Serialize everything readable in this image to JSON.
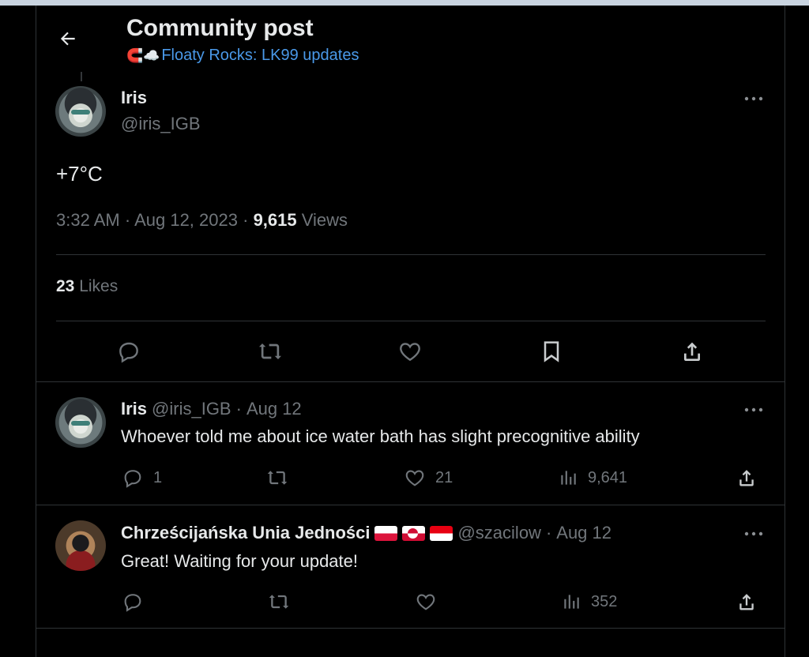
{
  "header": {
    "title": "Community post",
    "community_emoji": "🧲☁️",
    "community_name": "Floaty Rocks: LK99 updates"
  },
  "main_post": {
    "author_name": "Iris",
    "author_handle": "@iris_IGB",
    "text": "+7°C",
    "time": "3:32 AM",
    "date": "Aug 12, 2023",
    "views_count": "9,615",
    "views_label": "Views",
    "likes_count": "23",
    "likes_label": "Likes"
  },
  "replies": [
    {
      "author_name": "Iris",
      "author_handle": "@iris_IGB",
      "date": "Aug 12",
      "text": "Whoever told me about ice water bath has slight precognitive ability",
      "reply_count": "1",
      "like_count": "21",
      "view_count": "9,641"
    },
    {
      "author_name": "Chrześcijańska Unia Jedności",
      "author_handle": "@szacilow",
      "date": "Aug 12",
      "text": "Great! Waiting for your update!",
      "reply_count": "",
      "like_count": "",
      "view_count": "352"
    }
  ],
  "separator": "·",
  "colors": {
    "background": "#000000",
    "text": "#e7e9ea",
    "muted": "#71767b",
    "link": "#4a99e9",
    "border": "#2f3336"
  }
}
